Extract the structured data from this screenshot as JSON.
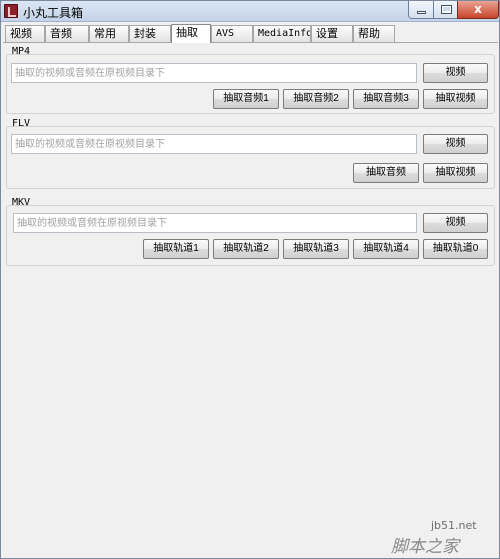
{
  "window": {
    "title": "小丸工具箱",
    "close_glyph": "x"
  },
  "tabs": [
    {
      "label": "视频",
      "active": false
    },
    {
      "label": "音频",
      "active": false
    },
    {
      "label": "常用",
      "active": false
    },
    {
      "label": "封装",
      "active": false
    },
    {
      "label": "抽取",
      "active": true
    },
    {
      "label": "AVS",
      "active": false
    },
    {
      "label": "MediaInfo",
      "active": false
    },
    {
      "label": "设置",
      "active": false
    },
    {
      "label": "帮助",
      "active": false
    }
  ],
  "mp4": {
    "label": "MP4",
    "placeholder": "抽取的视频或音频在原视频目录下",
    "browse_label": "视频",
    "buttons": [
      "抽取音频1",
      "抽取音频2",
      "抽取音频3",
      "抽取视频"
    ]
  },
  "flv": {
    "label": "FLV",
    "placeholder": "抽取的视频或音频在原视频目录下",
    "browse_label": "视频",
    "buttons": [
      "抽取音频",
      "抽取视频"
    ]
  },
  "mkv": {
    "label": "MKV",
    "placeholder": "抽取的视频或音频在原视频目录下",
    "browse_label": "视频",
    "buttons": [
      "抽取轨道1",
      "抽取轨道2",
      "抽取轨道3",
      "抽取轨道4",
      "抽取轨道0"
    ]
  },
  "watermark": {
    "site": "jb51.net",
    "name": "脚本之家"
  },
  "colors": {
    "title_bar": "#c3d3e8",
    "close_button": "#c7452b",
    "window_bg": "#f0f0f0"
  }
}
